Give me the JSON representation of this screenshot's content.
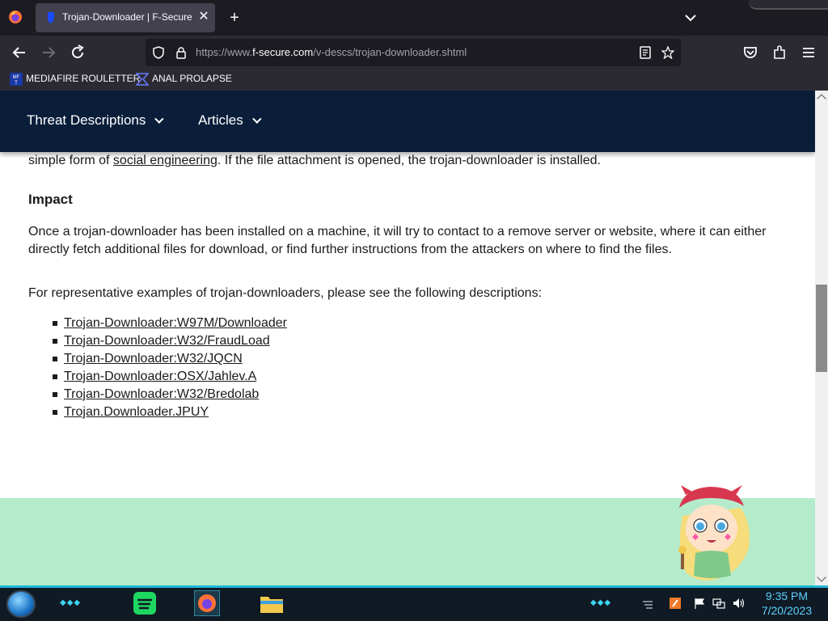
{
  "browser": {
    "tab": {
      "title": "Trojan-Downloader | F-Secure L",
      "close_glyph": "✕"
    },
    "new_tab_glyph": "+",
    "url": {
      "prefix": "https://www.",
      "domain": "f-secure.com",
      "path": "/v-descs/trojan-downloader.shtml"
    },
    "bookmarks": [
      {
        "label": "MEDIAFIRE ROULETTER",
        "icon": "mediafire-icon"
      },
      {
        "label": "ANAL PROLAPSE",
        "icon": "bookmark-page-icon"
      }
    ]
  },
  "site": {
    "nav": [
      {
        "label": "Threat Descriptions"
      },
      {
        "label": "Articles"
      }
    ]
  },
  "article": {
    "p0_before": "simple form of ",
    "p0_link": "social engineering",
    "p0_after": ". If the file attachment is opened, the trojan-downloader is installed.",
    "impact_heading": "Impact",
    "p1": "Once a trojan-downloader has been installed on a machine, it will try to contact to a remove server or website, where it can either directly fetch additional files for download, or find further instructions from the attackers on where to find the files.",
    "p2": "For representative examples of trojan-downloaders, please see the following descriptions:",
    "examples": [
      "Trojan-Downloader:W97M/Downloader",
      "Trojan-Downloader:W32/FraudLoad",
      "Trojan-Downloader:W32/JQCN",
      "Trojan-Downloader:OSX/Jahlev.A",
      "Trojan-Downloader:W32/Bredolab",
      "Trojan.Downloader.JPUY"
    ]
  },
  "taskbar": {
    "time": "9:35 PM",
    "date": "7/20/2023"
  },
  "colors": {
    "site_header": "#0a1e3a",
    "green_band": "#b4eccb",
    "clock": "#5fd0ff"
  }
}
